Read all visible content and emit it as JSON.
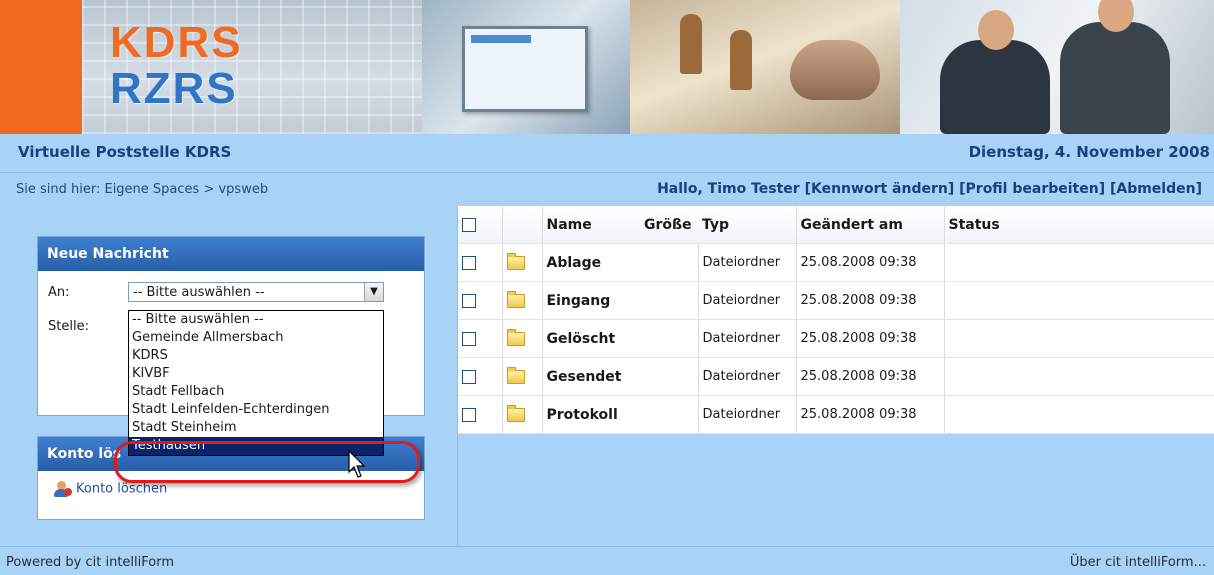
{
  "banner": {
    "logo_line1": "KDRS",
    "logo_line2": "RZRS"
  },
  "header": {
    "app_title": "Virtuelle Poststelle KDRS",
    "date": "Dienstag, 4. November 2008"
  },
  "nav": {
    "breadcrumb": "Sie sind hier: Eigene Spaces > vpsweb",
    "greeting": "Hallo, Timo Tester",
    "change_password": "[Kennwort ändern]",
    "edit_profile": "[Profil bearbeiten]",
    "logout": "[Abmelden]"
  },
  "new_message": {
    "title": "Neue Nachricht",
    "to_label": "An:",
    "office_label": "Stelle:",
    "select_value": "-- Bitte auswählen --",
    "options": [
      "-- Bitte auswählen --",
      "Gemeinde Allmersbach",
      "KDRS",
      "KIVBF",
      "Stadt Fellbach",
      "Stadt Leinfelden-Echterdingen",
      "Stadt Steinheim",
      "Testhausen"
    ],
    "selected_option": "Testhausen"
  },
  "account": {
    "title": "Konto lös",
    "delete_link": "Konto löschen"
  },
  "files": {
    "columns": [
      "Name",
      "Größe",
      "Typ",
      "Geändert am",
      "Status"
    ],
    "rows": [
      {
        "name": "Ablage",
        "size": "",
        "type": "Dateiordner",
        "modified": "25.08.2008 09:38",
        "status": ""
      },
      {
        "name": "Eingang",
        "size": "",
        "type": "Dateiordner",
        "modified": "25.08.2008 09:38",
        "status": ""
      },
      {
        "name": "Gelöscht",
        "size": "",
        "type": "Dateiordner",
        "modified": "25.08.2008 09:38",
        "status": ""
      },
      {
        "name": "Gesendet",
        "size": "",
        "type": "Dateiordner",
        "modified": "25.08.2008 09:38",
        "status": ""
      },
      {
        "name": "Protokoll",
        "size": "",
        "type": "Dateiordner",
        "modified": "25.08.2008 09:38",
        "status": ""
      }
    ]
  },
  "footer": {
    "powered_by": "Powered by cit intelliForm",
    "about": "Über cit intelliForm..."
  },
  "colors": {
    "background": "#a9d2f7",
    "panel_header": "#275fa9",
    "selected_option": "#0a246a",
    "highlight_ring": "#e21a1a",
    "logo_orange": "#ef6a22",
    "logo_blue": "#2f76c8"
  }
}
